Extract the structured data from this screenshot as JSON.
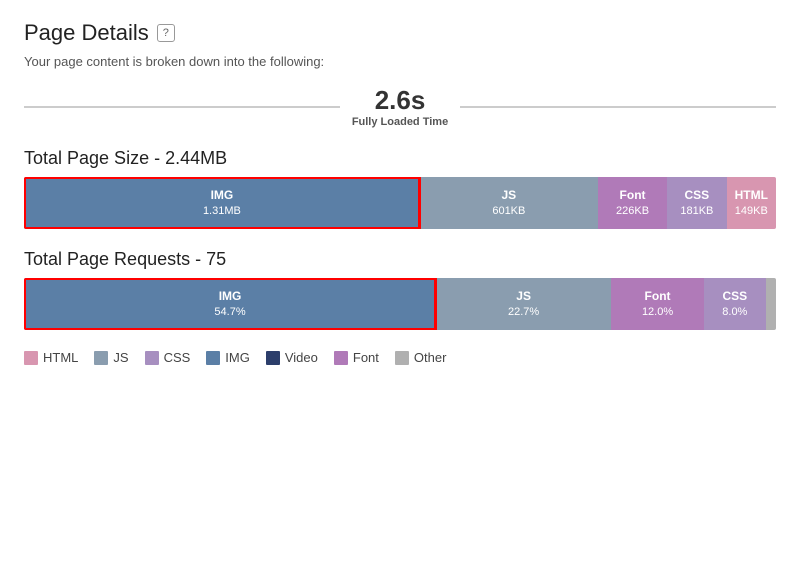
{
  "page": {
    "title": "Page Details",
    "help_label": "?",
    "subtitle": "Your page content is broken down into the following:"
  },
  "timeline": {
    "value": "2.6s",
    "label": "Fully Loaded Time"
  },
  "size_chart": {
    "title": "Total Page Size - 2.44MB",
    "segments": [
      {
        "id": "img",
        "label": "IMG",
        "value": "1.31MB",
        "color": "#5b7fa6",
        "flex": 40,
        "selected": true
      },
      {
        "id": "js",
        "label": "JS",
        "value": "601KB",
        "color": "#8a9daf",
        "flex": 18,
        "selected": false
      },
      {
        "id": "font",
        "label": "Font",
        "value": "226KB",
        "color": "#b07ab8",
        "flex": 7,
        "selected": false
      },
      {
        "id": "css",
        "label": "CSS",
        "value": "181KB",
        "color": "#a78fc0",
        "flex": 6,
        "selected": false
      },
      {
        "id": "html",
        "label": "HTML",
        "value": "149KB",
        "color": "#d896b0",
        "flex": 5,
        "selected": false
      }
    ]
  },
  "requests_chart": {
    "title": "Total Page Requests - 75",
    "segments": [
      {
        "id": "img",
        "label": "IMG",
        "value": "54.7%",
        "color": "#5b7fa6",
        "flex": 40,
        "selected": true
      },
      {
        "id": "js",
        "label": "JS",
        "value": "22.7%",
        "color": "#8a9daf",
        "flex": 17,
        "selected": false
      },
      {
        "id": "font",
        "label": "Font",
        "value": "12.0%",
        "color": "#b07ab8",
        "flex": 9,
        "selected": false
      },
      {
        "id": "css",
        "label": "CSS",
        "value": "8.0%",
        "color": "#a78fc0",
        "flex": 6,
        "selected": false
      },
      {
        "id": "other",
        "label": "",
        "value": "",
        "color": "#b0b0b0",
        "flex": 1,
        "selected": false
      }
    ]
  },
  "legend": {
    "items": [
      {
        "id": "html",
        "label": "HTML",
        "color": "#d896b0"
      },
      {
        "id": "js",
        "label": "JS",
        "color": "#8a9daf"
      },
      {
        "id": "css",
        "label": "CSS",
        "color": "#a78fc0"
      },
      {
        "id": "img",
        "label": "IMG",
        "color": "#5b7fa6"
      },
      {
        "id": "video",
        "label": "Video",
        "color": "#2c3e6b"
      },
      {
        "id": "font",
        "label": "Font",
        "color": "#b07ab8"
      },
      {
        "id": "other",
        "label": "Other",
        "color": "#b0b0b0"
      }
    ]
  }
}
